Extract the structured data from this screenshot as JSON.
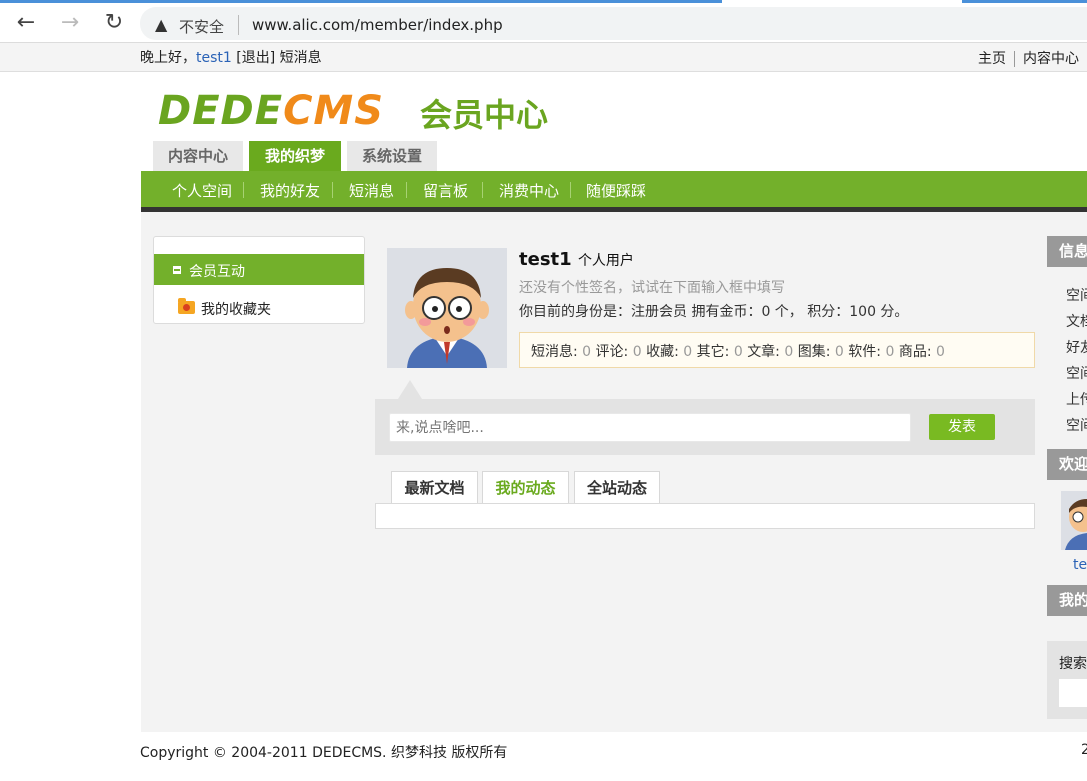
{
  "browser": {
    "security_warning": "不安全",
    "url": "www.alic.com/member/index.php",
    "icons": {
      "back": "back-arrow-icon",
      "forward": "forward-arrow-icon",
      "reload": "reload-icon",
      "warning": "warning-triangle-icon"
    }
  },
  "topbar": {
    "greeting": "晚上好，",
    "username": "test1",
    "logout": "[退出]",
    "messages": "短消息",
    "home": "主页",
    "content_center": "内容中心"
  },
  "logo": {
    "dede": "DEDE",
    "cms": "CMS",
    "center": "会员中心"
  },
  "main_tabs": [
    "内容中心",
    "我的织梦",
    "系统设置"
  ],
  "sub_nav": [
    "个人空间",
    "我的好友",
    "短消息",
    "留言板",
    "消费中心",
    "随便踩踩"
  ],
  "sidebar": {
    "section": "会员互动",
    "items": [
      "我的收藏夹"
    ]
  },
  "profile": {
    "name": "test1",
    "type": "个人用户",
    "signature": "还没有个性签名，试试在下面输入框中填写",
    "identity": "你目前的身份是：注册会员 拥有金币：0 个， 积分：100 分。",
    "stats": [
      {
        "label": "短消息:",
        "value": "0"
      },
      {
        "label": "评论:",
        "value": "0"
      },
      {
        "label": "收藏:",
        "value": "0"
      },
      {
        "label": "其它:",
        "value": "0"
      },
      {
        "label": "文章:",
        "value": "0"
      },
      {
        "label": "图集:",
        "value": "0"
      },
      {
        "label": "软件:",
        "value": "0"
      },
      {
        "label": "商品:",
        "value": "0"
      }
    ]
  },
  "post": {
    "placeholder": "来,说点啥吧...",
    "button": "发表"
  },
  "feed_tabs": [
    "最新文档",
    "我的动态",
    "全站动态"
  ],
  "right_column": {
    "info_header": "信息",
    "info_items": [
      "空间",
      "文档",
      "好友",
      "空间",
      "上传",
      "空间"
    ],
    "welcome_header": "欢迎",
    "welcome_user": "te",
    "my_header": "我的",
    "search_label": "搜索"
  },
  "footer": {
    "copyright": "Copyright © 2004-2011 DEDECMS. 织梦科技 版权所有",
    "right": "2"
  },
  "colors": {
    "green": "#73b02b",
    "tab_active": "#6aaa1e",
    "logo_orange": "#f08a1a",
    "link_blue": "#2a62b6"
  }
}
